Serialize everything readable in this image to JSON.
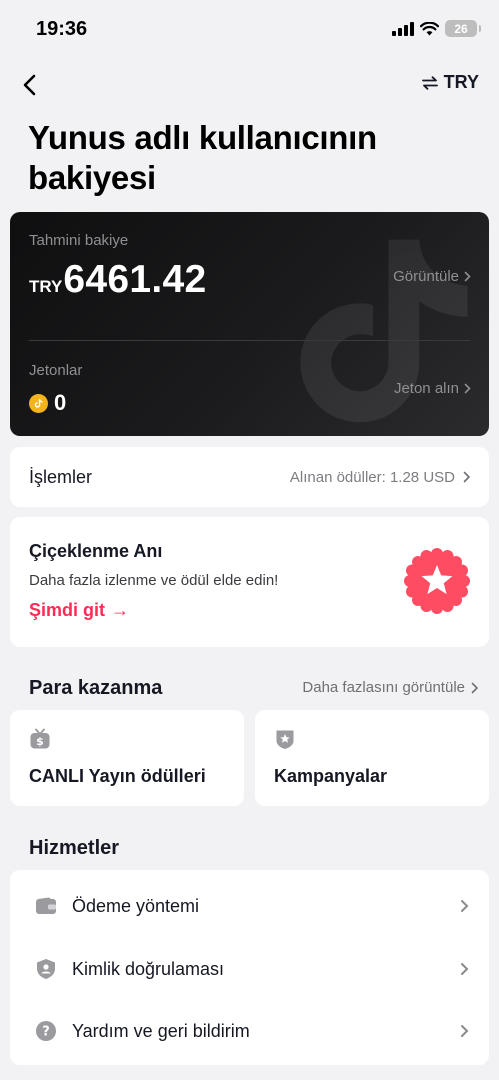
{
  "status_bar": {
    "time": "19:36",
    "battery": "26"
  },
  "nav": {
    "currency_label": "TRY"
  },
  "title": "Yunus adlı kullanıcının bakiyesi",
  "balance": {
    "estimated_label": "Tahmini bakiye",
    "currency": "TRY",
    "amount": "6461.42",
    "view_label": "Görüntüle",
    "coins_label": "Jetonlar",
    "coins_value": "0",
    "get_coins_label": "Jeton alın"
  },
  "transactions": {
    "title": "İşlemler",
    "rewards_text": "Alınan ödüller: 1.28 USD"
  },
  "promo": {
    "title": "Çiçeklenme Anı",
    "subtitle": "Daha fazla izlenme ve ödül elde edin!",
    "cta": "Şimdi git",
    "arrow": "→"
  },
  "monetization": {
    "title": "Para kazanma",
    "see_more": "Daha fazlasını görüntüle",
    "tiles": [
      {
        "label": "CANLI Yayın ödülleri",
        "icon": "live-gift-icon"
      },
      {
        "label": "Kampanyalar",
        "icon": "campaign-badge-icon"
      }
    ]
  },
  "services": {
    "title": "Hizmetler",
    "items": [
      {
        "label": "Ödeme yöntemi",
        "icon": "wallet-icon"
      },
      {
        "label": "Kimlik doğrulaması",
        "icon": "id-shield-icon"
      },
      {
        "label": "Yardım ve geri bildirim",
        "icon": "help-icon"
      }
    ]
  },
  "colors": {
    "accent": "#fe2c55",
    "card_dark": "#161616",
    "background": "#f2f2f4",
    "coin": "#f5b41b",
    "icon_gray": "#9a9a9f"
  }
}
